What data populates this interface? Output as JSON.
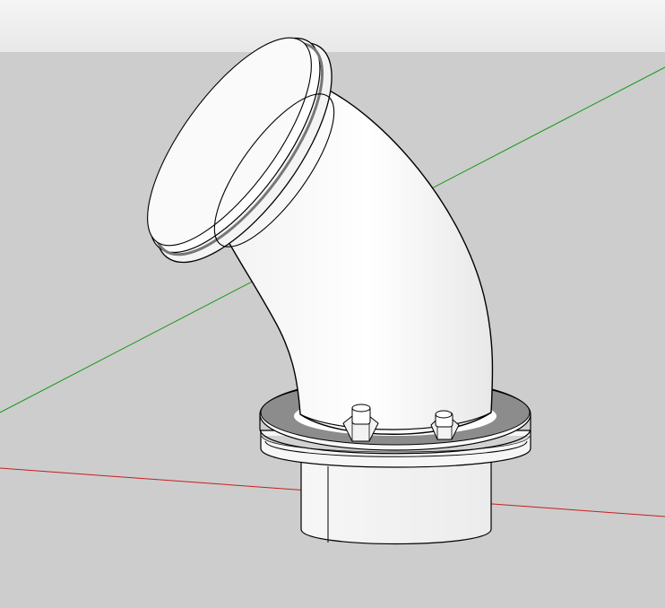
{
  "viewport": {
    "sky_color": "#ededed",
    "ground_color": "#cdcdcd",
    "axis_green_color": "#1a9a1a",
    "axis_red_color": "#c81e1e",
    "model_face_color": "#ffffff",
    "model_edge_color": "#000000",
    "model_shadow_color": "#7f7f7f"
  },
  "scene": {
    "model": "pipe-elbow-with-flanges",
    "icons": [
      "sky-gradient",
      "ground-plane",
      "green-axis",
      "red-axis"
    ]
  }
}
